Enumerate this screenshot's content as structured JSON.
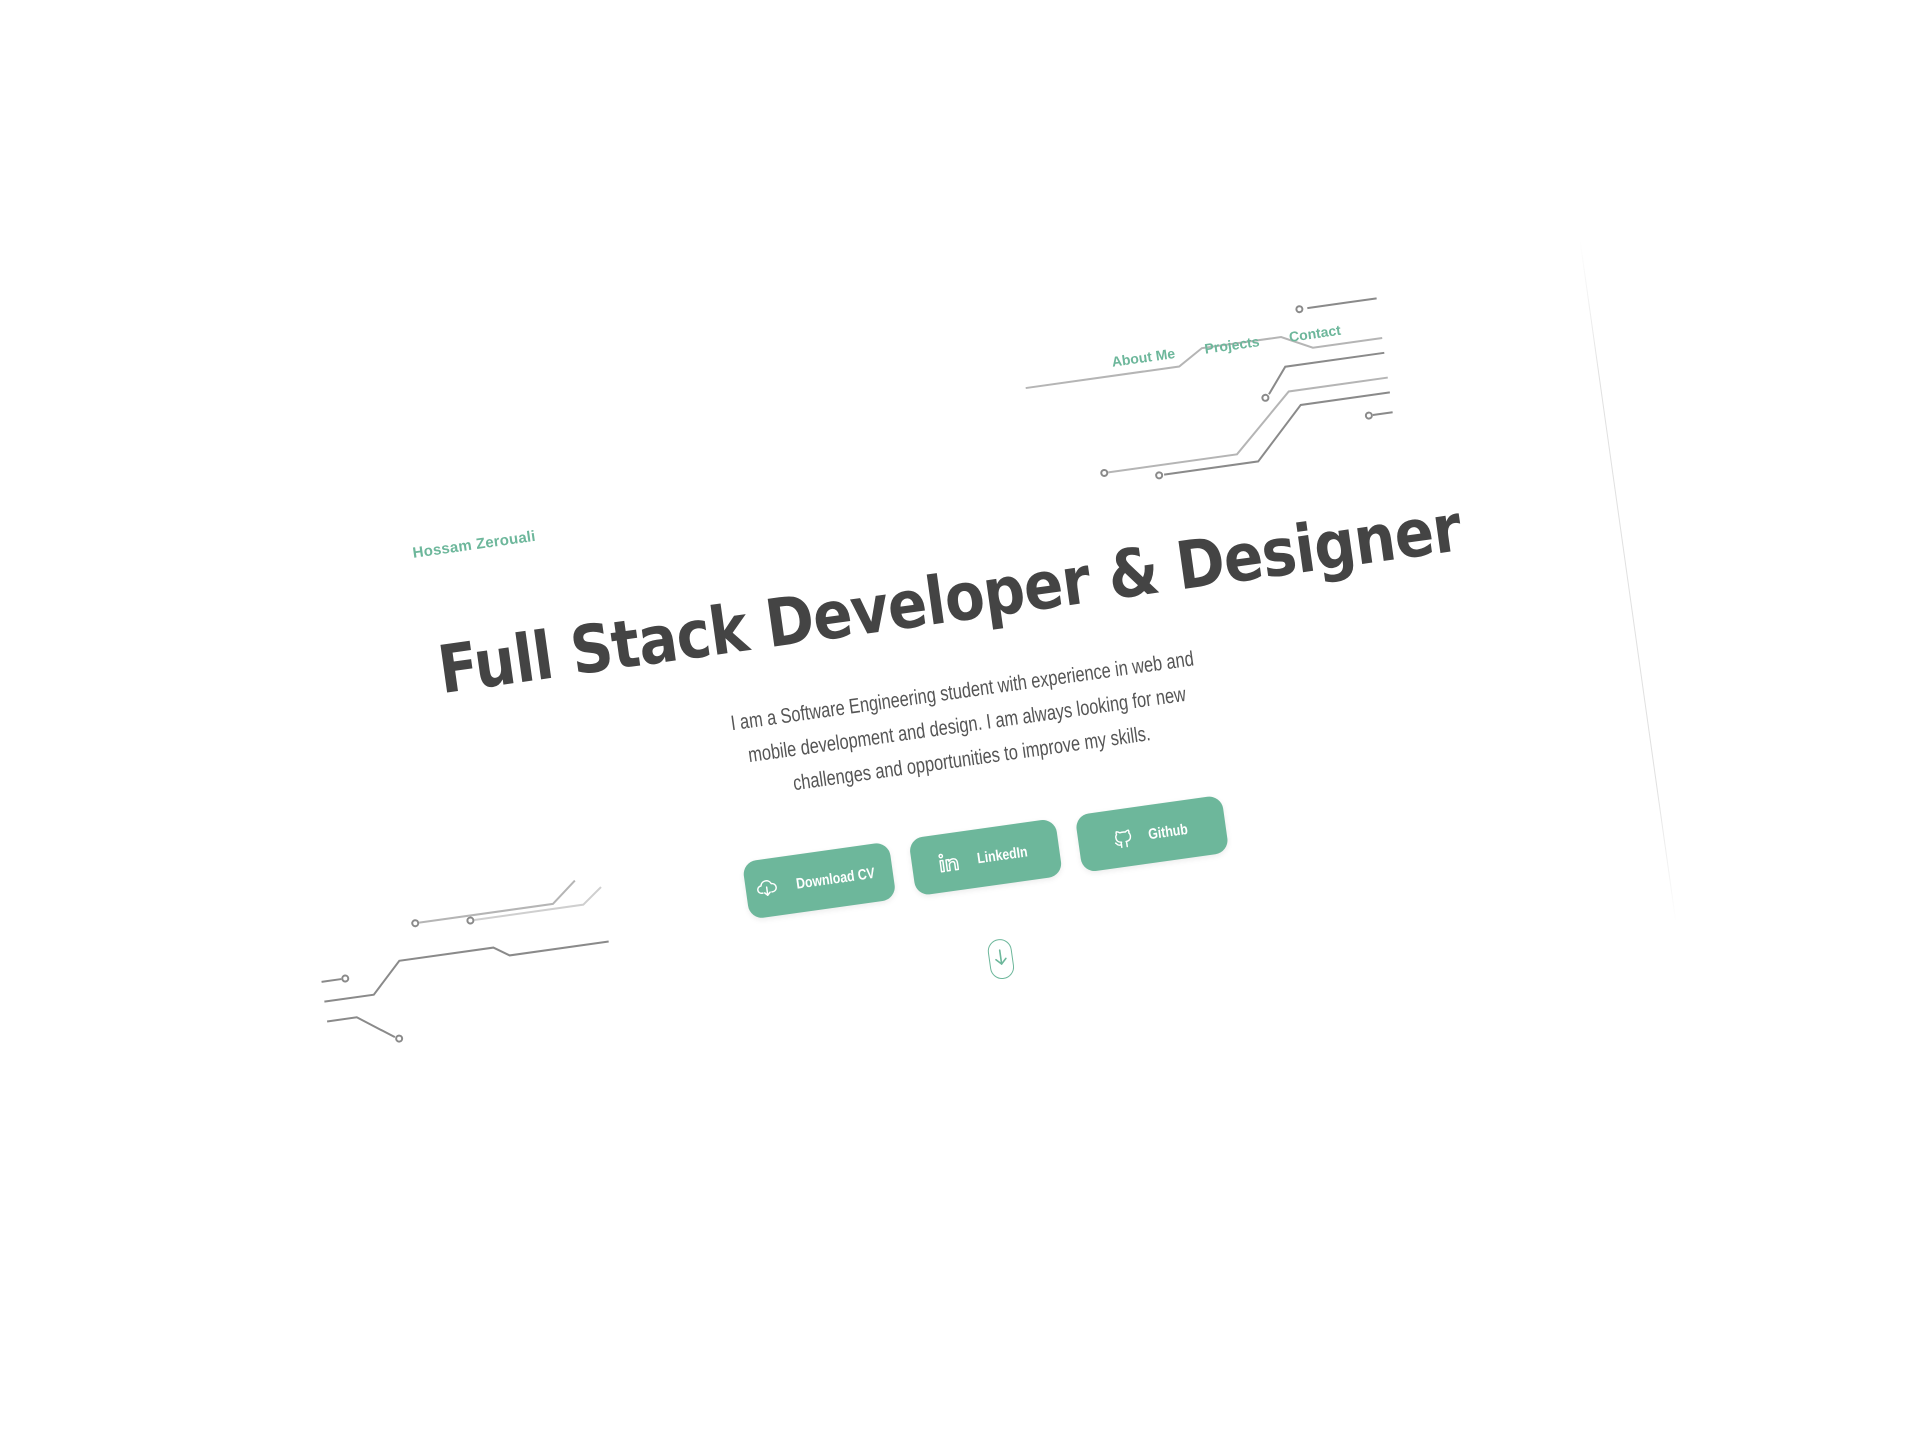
{
  "header": {
    "brand": "Hossam Zerouali",
    "nav": [
      {
        "label": "About Me"
      },
      {
        "label": "Projects"
      },
      {
        "label": "Contact"
      }
    ]
  },
  "hero": {
    "title": "Full Stack Developer & Designer",
    "description": "I am a Software Engineering student with experience in web and mobile development and design. I am always looking for new challenges and opportunities to improve my skills.",
    "buttons": [
      {
        "label": "Download CV",
        "icon": "cloud-download-icon"
      },
      {
        "label": "LinkedIn",
        "icon": "linkedin-icon"
      },
      {
        "label": "Github",
        "icon": "github-icon"
      }
    ],
    "scroll_icon": "arrow-down-icon"
  },
  "colors": {
    "accent": "#6db79b",
    "heading": "#444444",
    "body_text": "#555555",
    "circuit_line": "#8a8a8a"
  }
}
